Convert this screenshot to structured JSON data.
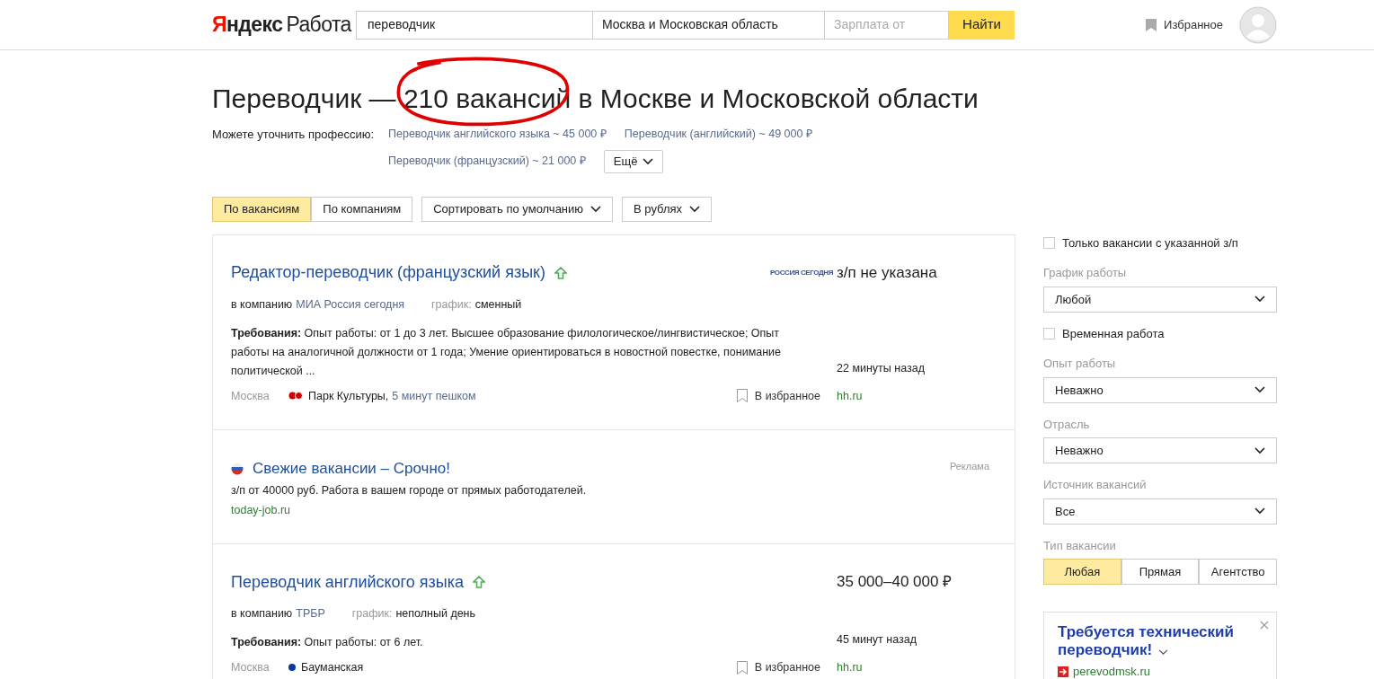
{
  "header": {
    "logo": {
      "brand": "Яндекс",
      "product": "Работа"
    },
    "search": {
      "value": "переводчик"
    },
    "region": {
      "value": "Москва и Московская область"
    },
    "salary": {
      "placeholder": "Зарплата от"
    },
    "search_button": "Найти",
    "favorites": "Избранное"
  },
  "heading": "Переводчик — 210 вакансий в Москве и Московской области",
  "refine": {
    "label": "Можете уточнить профессию:",
    "options": [
      "Переводчик английского языка ~ 45 000 ₽",
      "Переводчик (английский) ~ 49 000 ₽",
      "Переводчик (французский) ~ 21 000 ₽"
    ],
    "more": "Ещё"
  },
  "view_tabs": [
    {
      "label": "По вакансиям",
      "selected": true
    },
    {
      "label": "По компаниям",
      "selected": false
    }
  ],
  "sort": "Сортировать по умолчанию",
  "currency": "В рублях",
  "results": [
    {
      "kind": "vacancy",
      "title": "Редактор-переводчик (французский язык)",
      "promoted": true,
      "logo_text": "РОССИЯ СЕГОДНЯ",
      "salary": "з/п не указана",
      "company_prefix": "в компанию",
      "company": "МИА Россия сегодня",
      "schedule_label": "график:",
      "schedule": "сменный",
      "requirements_label": "Требования:",
      "requirements": "Опыт работы: от 1 до 3 лет. Высшее образование филологическое/лингвистическое; Опыт работы на аналогичной должности от 1 года; Умение ориентироваться в новостной повестке, понимание политической ...",
      "time": "22 минуты назад",
      "city": "Москва",
      "metro": {
        "name": "Парк Культуры,",
        "walk": "5 минут пешком",
        "color": "#cc0000",
        "interchange": true
      },
      "favorite": "В избранное",
      "source": "hh.ru"
    },
    {
      "kind": "ad",
      "title": "Свежие вакансии – Срочно!",
      "text": "з/п от 40000 руб. Работа в вашем городе от прямых работодателей.",
      "url": "today-job.ru",
      "label": "Реклама"
    },
    {
      "kind": "vacancy",
      "title": "Переводчик английского языка",
      "promoted": true,
      "salary": "35 000–40 000 ₽",
      "company_prefix": "в компанию",
      "company": "ТРБР",
      "schedule_label": "график:",
      "schedule": "неполный день",
      "requirements_label": "Требования:",
      "requirements": "Опыт работы: от 6 лет.",
      "time": "45 минут назад",
      "city": "Москва",
      "metro": {
        "name": "Бауманская",
        "color": "#0a3a9a",
        "interchange": false
      },
      "favorite": "В избранное",
      "source": "hh.ru"
    }
  ],
  "filters": [
    {
      "kind": "checkbox",
      "label": "Только вакансии с указанной з/п",
      "checked": false
    },
    {
      "kind": "select",
      "label": "График работы",
      "value": "Любой"
    },
    {
      "kind": "checkbox",
      "label": "Временная работа",
      "checked": false
    },
    {
      "kind": "select",
      "label": "Опыт работы",
      "value": "Неважно"
    },
    {
      "kind": "select",
      "label": "Отрасль",
      "value": "Неважно"
    },
    {
      "kind": "select",
      "label": "Источник вакансий",
      "value": "Все"
    },
    {
      "kind": "segmented",
      "label": "Тип вакансии",
      "options": [
        {
          "label": "Любая",
          "selected": true
        },
        {
          "label": "Прямая",
          "selected": false
        },
        {
          "label": "Агентство",
          "selected": false
        }
      ]
    }
  ],
  "promo": {
    "title": "Требуется технический переводчик!",
    "url": "perevodmsk.ru"
  }
}
